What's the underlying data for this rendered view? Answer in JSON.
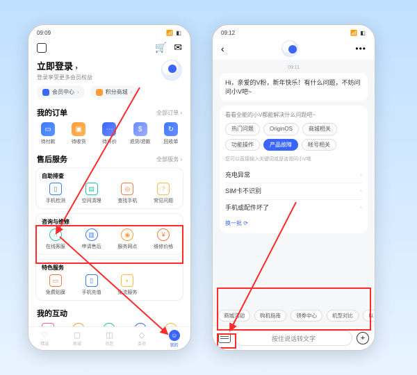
{
  "left": {
    "status_time": "09:09",
    "login": {
      "title": "立即登录",
      "sub": "登录享受更多会员权益"
    },
    "pills": {
      "member": "会员中心",
      "points": "积分商城"
    },
    "orders": {
      "head": "我的订单",
      "more": "全部订单",
      "items": [
        {
          "label": "待付款"
        },
        {
          "label": "待收货"
        },
        {
          "label": "待评价"
        },
        {
          "label": "退货/退款"
        },
        {
          "label": "回收单"
        }
      ]
    },
    "aftersale": {
      "head": "售后服务",
      "more": "全部服务",
      "g1_title": "自助排查",
      "g1": [
        {
          "label": "手机检测"
        },
        {
          "label": "空间清理"
        },
        {
          "label": "查找手机"
        },
        {
          "label": "常见问题"
        }
      ],
      "g2_title": "咨询与维修",
      "g2": [
        {
          "label": "在线客服"
        },
        {
          "label": "申请售后"
        },
        {
          "label": "服务网点"
        },
        {
          "label": "维修价格"
        }
      ],
      "g3_title": "特色服务",
      "g3": [
        {
          "label": "免费贴膜"
        },
        {
          "label": "手机充值"
        },
        {
          "label": "免流服务"
        }
      ]
    },
    "interact_head": "我的互动",
    "tabs": [
      {
        "label": "精选"
      },
      {
        "label": "商城"
      },
      {
        "label": "社区"
      },
      {
        "label": "会员"
      },
      {
        "label": "我的"
      }
    ]
  },
  "right": {
    "status_time": "09:12",
    "time_stamp": "09:11",
    "greeting": "Hi，亲爱的V粉，新年快乐！有什么问题，不妨问问小V吧~",
    "bub_head": "看看全能的小V都能解决什么问题吧~",
    "chips": [
      "热门问题",
      "OriginOS",
      "商城相关",
      "功能操作",
      "产品故障",
      "帐号相关"
    ],
    "chip_active_index": 4,
    "bub_sub": "您可以直接输入关键词或是咨询问小V哦",
    "links": [
      "充电异常",
      "SIM卡不识别",
      "手机或配件坏了"
    ],
    "refresh": "换一批",
    "bottom_chips": [
      "商城活动",
      "购机指南",
      "领券中心",
      "机型对比",
      "以"
    ],
    "voice_placeholder": "按住说话转文字"
  }
}
